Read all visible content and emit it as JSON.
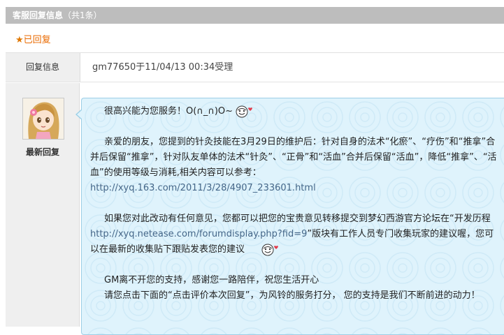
{
  "header": {
    "title": "客服回复信息",
    "count": "（共1条）"
  },
  "replied": {
    "star": "★",
    "label": "已回复"
  },
  "reply_info": {
    "label": "回复信息",
    "value": "gm77650于11/04/13 00:34受理"
  },
  "sidebar": {
    "latest_label": "最新回复"
  },
  "message": {
    "greeting": "很高兴能为您服务！O(∩_∩)O~",
    "para1": "亲爱的朋友，您提到的针灸技能在3月29日的维护后：针对自身的法术“化瘀”、“疗伤”和“推拿”合并后保留“推拿”，针对队友单体的法术“针灸”、“正骨”和“活血”合并后保留“活血”，降低“推拿”、“活血”的使用等级与消耗,相关内容可以参考：",
    "link1": "http://xyq.163.com/2011/3/28/4907_233601.html",
    "para2_a": "如果您对此改动有任何意见，您都可以把您的宝贵意见转移提交到梦幻西游官方论坛在“开发历程",
    "link2": "http://xyq.netease.com/forumdisplay.php?fid=9",
    "para2_b": "”版块有工作人员专门收集玩家的建议喔，您可以在最新的收集贴下跟贴发表您的建议",
    "para3_a": "GM离不开您的支持，感谢您一路陪伴，祝您生活开心",
    "para3_b": "请您点击下面的“点击评价本次回复”，为风铃的服务打分， 您的支持是我们不断前进的动力！"
  },
  "icons": {
    "emoji": "smiley-heart-icon",
    "avatar": "avatar"
  },
  "colors": {
    "header_bg": "#bdbdbd",
    "replied_text": "#ea6a00",
    "bubble_bg": "#dff3fc",
    "bubble_border": "#9ccfe6",
    "link": "#446688"
  }
}
